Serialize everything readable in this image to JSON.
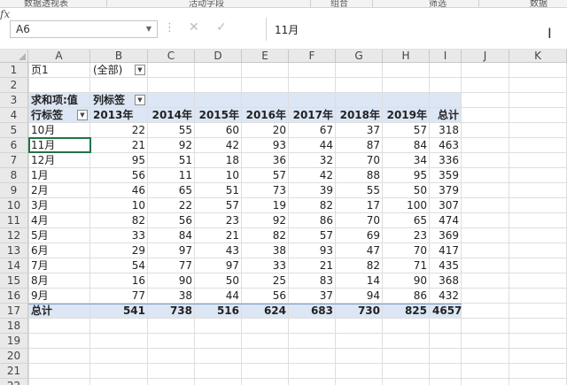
{
  "ribbon": {
    "groups": [
      "数据透视表",
      "活动字段",
      "组合",
      "筛选",
      "数据"
    ]
  },
  "formula_bar": {
    "name_box": "A6",
    "cancel_icon": "close-icon",
    "enter_icon": "check-icon",
    "fx_label": "fx",
    "formula_value": "11月"
  },
  "sheet": {
    "columns": [
      "A",
      "B",
      "C",
      "D",
      "E",
      "F",
      "G",
      "H",
      "I",
      "J",
      "K"
    ],
    "row_numbers": [
      "1",
      "2",
      "3",
      "4",
      "5",
      "6",
      "7",
      "8",
      "9",
      "10",
      "11",
      "12",
      "13",
      "14",
      "15",
      "16",
      "17",
      "18",
      "19",
      "20",
      "21",
      "22"
    ],
    "active_cell": "A6"
  },
  "pivot": {
    "filter_label": "页1",
    "filter_value": "(全部)",
    "value_label": "求和项:值",
    "col_label": "列标签",
    "row_label": "行标签",
    "year_headers": [
      "2013年",
      "2014年",
      "2015年",
      "2016年",
      "2017年",
      "2018年",
      "2019年",
      "总计"
    ],
    "rows": [
      {
        "label": "10月",
        "values": [
          "22",
          "55",
          "60",
          "20",
          "67",
          "37",
          "57",
          "318"
        ]
      },
      {
        "label": "11月",
        "values": [
          "21",
          "92",
          "42",
          "93",
          "44",
          "87",
          "84",
          "463"
        ]
      },
      {
        "label": "12月",
        "values": [
          "95",
          "51",
          "18",
          "36",
          "32",
          "70",
          "34",
          "336"
        ]
      },
      {
        "label": "1月",
        "values": [
          "56",
          "11",
          "10",
          "57",
          "42",
          "88",
          "95",
          "359"
        ]
      },
      {
        "label": "2月",
        "values": [
          "46",
          "65",
          "51",
          "73",
          "39",
          "55",
          "50",
          "379"
        ]
      },
      {
        "label": "3月",
        "values": [
          "10",
          "22",
          "57",
          "19",
          "82",
          "17",
          "100",
          "307"
        ]
      },
      {
        "label": "4月",
        "values": [
          "82",
          "56",
          "23",
          "92",
          "86",
          "70",
          "65",
          "474"
        ]
      },
      {
        "label": "5月",
        "values": [
          "33",
          "84",
          "21",
          "82",
          "57",
          "69",
          "23",
          "369"
        ]
      },
      {
        "label": "6月",
        "values": [
          "29",
          "97",
          "43",
          "38",
          "93",
          "47",
          "70",
          "417"
        ]
      },
      {
        "label": "7月",
        "values": [
          "54",
          "77",
          "97",
          "33",
          "21",
          "82",
          "71",
          "435"
        ]
      },
      {
        "label": "8月",
        "values": [
          "16",
          "90",
          "50",
          "25",
          "83",
          "14",
          "90",
          "368"
        ]
      },
      {
        "label": "9月",
        "values": [
          "77",
          "38",
          "44",
          "56",
          "37",
          "94",
          "86",
          "432"
        ]
      }
    ],
    "total": {
      "label": "总计",
      "values": [
        "541",
        "738",
        "516",
        "624",
        "683",
        "730",
        "825",
        "4657"
      ]
    }
  },
  "colors": {
    "pivot_band": "#dce6f4",
    "selection": "#217346"
  }
}
